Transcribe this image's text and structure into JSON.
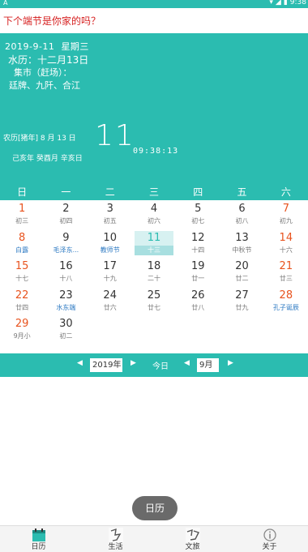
{
  "status_bar": {
    "left_icon": "A",
    "time": "9:38",
    "icons": [
      "wifi-icon",
      "signal-icon",
      "battery-icon"
    ]
  },
  "topbar": {
    "title": "下个端节是你家的吗？"
  },
  "hero": {
    "date": "2019-9-11",
    "weekday": "星期三",
    "water_calendar": "水历：十二月13日",
    "market_label": "集市（赶场）：",
    "market_towns": "廷牌、九阡、合江",
    "lunar_year": "农历[猪年]",
    "lunar_month_day": "8 月 13 日",
    "ganzhi": "己亥年 癸酉月 辛亥日",
    "big_day": "11",
    "clock": "09:38:13"
  },
  "calendar": {
    "weekdays": [
      "日",
      "一",
      "二",
      "三",
      "四",
      "五",
      "六"
    ],
    "rows": [
      [
        {
          "num": "1",
          "sub": "初三",
          "num_red": true,
          "sub_blue": false
        },
        {
          "num": "2",
          "sub": "初四",
          "num_red": false,
          "sub_blue": false
        },
        {
          "num": "3",
          "sub": "初五",
          "num_red": false,
          "sub_blue": false
        },
        {
          "num": "4",
          "sub": "初六",
          "num_red": false,
          "sub_blue": false
        },
        {
          "num": "5",
          "sub": "初七",
          "num_red": false,
          "sub_blue": false
        },
        {
          "num": "6",
          "sub": "初八",
          "num_red": false,
          "sub_blue": false
        },
        {
          "num": "7",
          "sub": "初九",
          "num_red": true,
          "sub_blue": false
        }
      ],
      [
        {
          "num": "8",
          "sub": "白露",
          "num_red": true,
          "sub_blue": true
        },
        {
          "num": "9",
          "sub": "毛泽东...",
          "num_red": false,
          "sub_blue": true
        },
        {
          "num": "10",
          "sub": "教师节",
          "num_red": false,
          "sub_blue": true
        },
        {
          "num": "11",
          "sub": "十三",
          "num_red": false,
          "sub_blue": false,
          "today": true
        },
        {
          "num": "12",
          "sub": "十四",
          "num_red": false,
          "sub_blue": false
        },
        {
          "num": "13",
          "sub": "中秋节",
          "num_red": false,
          "sub_blue": false
        },
        {
          "num": "14",
          "sub": "十六",
          "num_red": true,
          "sub_blue": false
        }
      ],
      [
        {
          "num": "15",
          "sub": "十七",
          "num_red": true,
          "sub_blue": false
        },
        {
          "num": "16",
          "sub": "十八",
          "num_red": false,
          "sub_blue": false
        },
        {
          "num": "17",
          "sub": "十九",
          "num_red": false,
          "sub_blue": false
        },
        {
          "num": "18",
          "sub": "二十",
          "num_red": false,
          "sub_blue": false
        },
        {
          "num": "19",
          "sub": "廿一",
          "num_red": false,
          "sub_blue": false
        },
        {
          "num": "20",
          "sub": "廿二",
          "num_red": false,
          "sub_blue": false
        },
        {
          "num": "21",
          "sub": "廿三",
          "num_red": true,
          "sub_blue": false
        }
      ],
      [
        {
          "num": "22",
          "sub": "廿四",
          "num_red": true,
          "sub_blue": false
        },
        {
          "num": "23",
          "sub": "水东端",
          "num_red": false,
          "sub_blue": true
        },
        {
          "num": "24",
          "sub": "廿六",
          "num_red": false,
          "sub_blue": false
        },
        {
          "num": "25",
          "sub": "廿七",
          "num_red": false,
          "sub_blue": false
        },
        {
          "num": "26",
          "sub": "廿八",
          "num_red": false,
          "sub_blue": false
        },
        {
          "num": "27",
          "sub": "廿九",
          "num_red": false,
          "sub_blue": false
        },
        {
          "num": "28",
          "sub": "孔子诞辰",
          "num_red": true,
          "sub_blue": true
        }
      ],
      [
        {
          "num": "29",
          "sub": "9月小",
          "num_red": true,
          "sub_blue": false
        },
        {
          "num": "30",
          "sub": "初二",
          "num_red": false,
          "sub_blue": false
        },
        {
          "num": "",
          "sub": ""
        },
        {
          "num": "",
          "sub": ""
        },
        {
          "num": "",
          "sub": ""
        },
        {
          "num": "",
          "sub": ""
        },
        {
          "num": "",
          "sub": ""
        }
      ]
    ]
  },
  "navigator": {
    "year_value": "2019年",
    "today_label": "今日",
    "month_value": "9月"
  },
  "toast": {
    "text": "日历"
  },
  "bottom_nav": [
    {
      "label": "日历",
      "icon": "calendar-icon"
    },
    {
      "label": "生活",
      "icon": "life-icon"
    },
    {
      "label": "文旅",
      "icon": "culture-icon"
    },
    {
      "label": "关于",
      "icon": "about-icon"
    }
  ],
  "colors": {
    "accent": "#2bbcb0",
    "weekend_red": "#e8531e",
    "festival_blue": "#2b78c2",
    "title_red": "#d62020"
  }
}
